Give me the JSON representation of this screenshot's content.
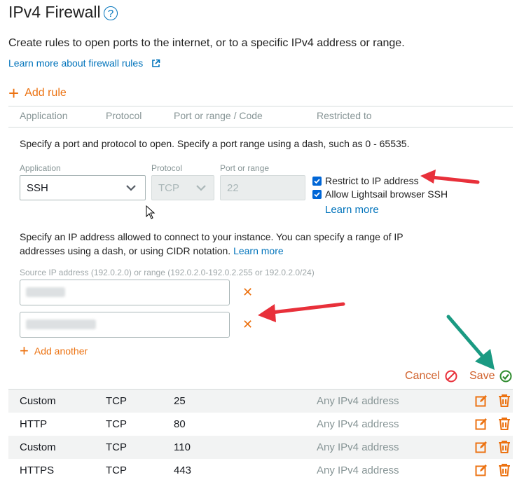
{
  "header": {
    "title": "IPv4 Firewall",
    "help_icon": "?"
  },
  "description": "Create rules to open ports to the internet, or to a specific IPv4 address or range.",
  "learn_link": "Learn more about firewall rules",
  "add_rule": "Add rule",
  "columns": [
    "Application",
    "Protocol",
    "Port or range / Code",
    "Restricted to"
  ],
  "editor": {
    "spec_text": "Specify a port and protocol to open. Specify a port range using a dash, such as 0 - 65535.",
    "application_label": "Application",
    "application_value": "SSH",
    "protocol_label": "Protocol",
    "protocol_value": "TCP",
    "port_label": "Port or range",
    "port_value": "22",
    "restrict_label": "Restrict to IP address",
    "restrict_checked": true,
    "allow_ssh_label": "Allow Lightsail browser SSH",
    "allow_ssh_checked": true,
    "learn_more": "Learn more",
    "ip_para": "Specify an IP address allowed to connect to your instance. You can specify a range of IP addresses using a dash, or using CIDR notation.",
    "ip_para_link": "Learn more",
    "source_label": "Source IP address (192.0.2.0) or range (192.0.2.0-192.0.2.255 or 192.0.2.0/24)",
    "add_another": "Add another",
    "cancel": "Cancel",
    "save": "Save"
  },
  "rules": [
    {
      "application": "Custom",
      "protocol": "TCP",
      "port": "25",
      "restricted": "Any IPv4 address"
    },
    {
      "application": "HTTP",
      "protocol": "TCP",
      "port": "80",
      "restricted": "Any IPv4 address"
    },
    {
      "application": "Custom",
      "protocol": "TCP",
      "port": "110",
      "restricted": "Any IPv4 address"
    },
    {
      "application": "HTTPS",
      "protocol": "TCP",
      "port": "443",
      "restricted": "Any IPv4 address"
    }
  ],
  "colors": {
    "accent": "#ec7211",
    "link": "#0073bb",
    "arrow_red": "#e8303a",
    "arrow_teal": "#1a9a82",
    "save_check": "#2e8b2e"
  }
}
